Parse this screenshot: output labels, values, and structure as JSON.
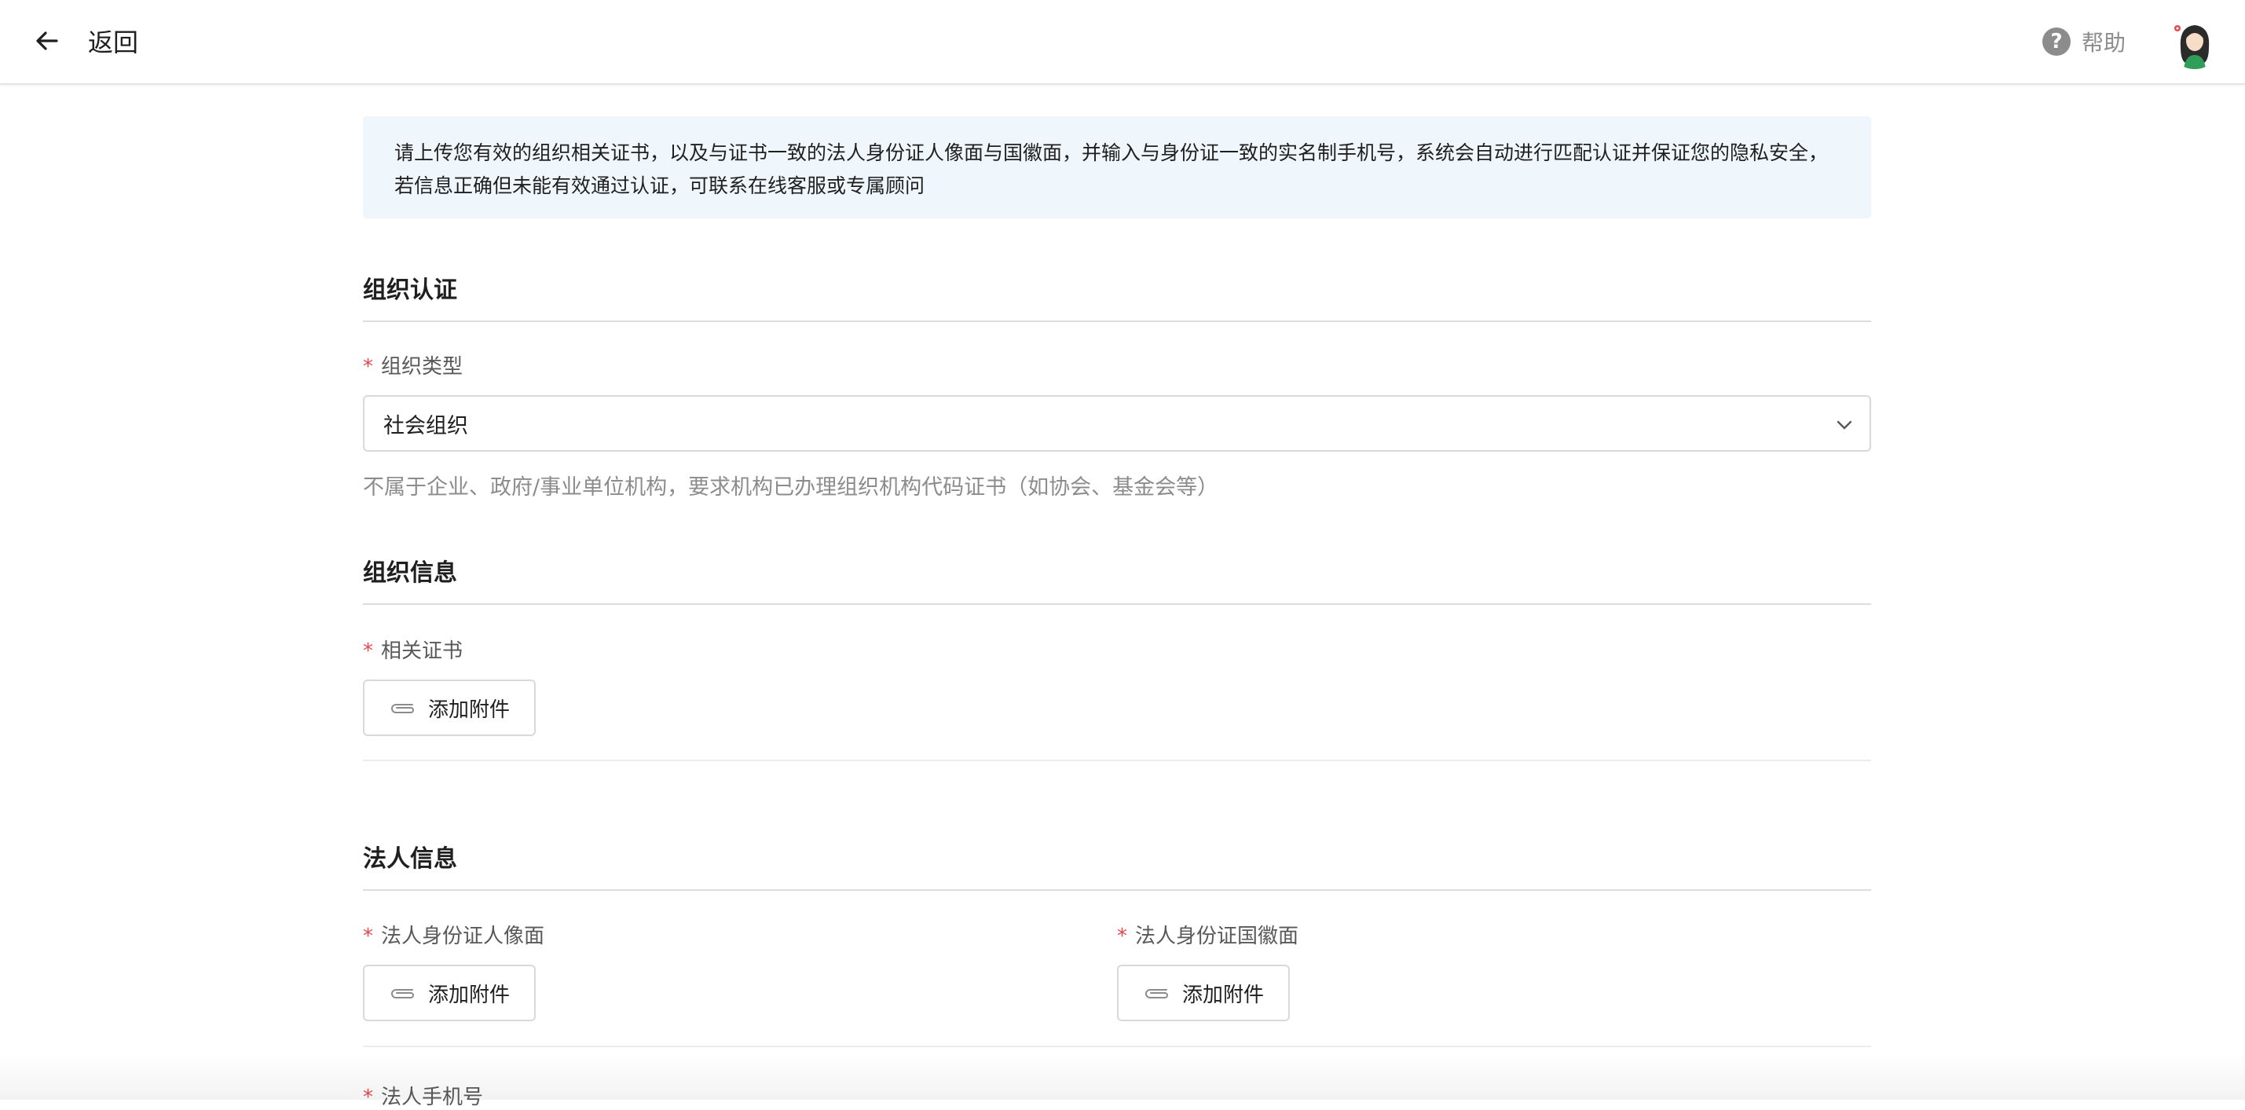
{
  "header": {
    "back_label": "返回",
    "help_label": "帮助",
    "help_glyph": "?"
  },
  "notice": {
    "text": "请上传您有效的组织相关证书，以及与证书一致的法人身份证人像面与国徽面，并输入与身份证一致的实名制手机号，系统会自动进行匹配认证并保证您的隐私安全，若信息正确但未能有效通过认证，可联系在线客服或专属顾问"
  },
  "org_auth": {
    "title": "组织认证",
    "type_label": "组织类型",
    "type_value": "社会组织",
    "type_hint": "不属于企业、政府/事业单位机构，要求机构已办理组织机构代码证书（如协会、基金会等）"
  },
  "org_info": {
    "title": "组织信息",
    "cert_label": "相关证书",
    "attach_label": "添加附件"
  },
  "legal_info": {
    "title": "法人信息",
    "id_front_label": "法人身份证人像面",
    "id_back_label": "法人身份证国徽面",
    "attach_label": "添加附件",
    "phone_label": "法人手机号"
  },
  "required_mark": "*",
  "colors": {
    "required": "#e5484d",
    "notice_bg": "#f0f7fc",
    "muted_text": "#8c8c8c",
    "border": "#d9d9d9"
  },
  "icons": {
    "back": "arrow-left",
    "help": "question-circle",
    "chevron": "chevron-down",
    "attach": "paperclip"
  }
}
